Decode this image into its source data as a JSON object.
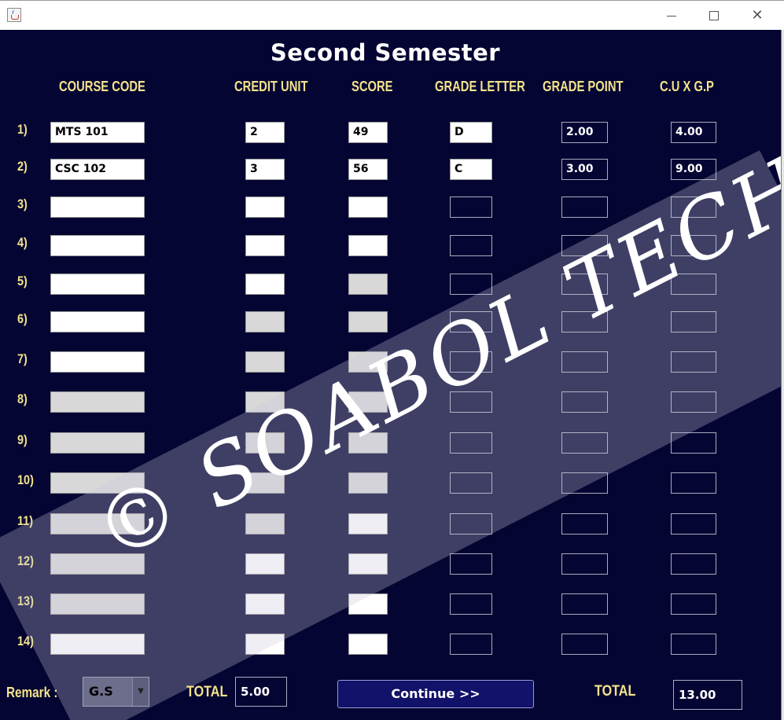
{
  "window": {
    "minimize_glyph": "",
    "maximize_glyph": "",
    "close_glyph": "✕"
  },
  "heading": "Second Semester",
  "columns": {
    "course_code": "COURSE CODE",
    "credit_unit": "CREDIT UNIT",
    "score": "SCORE",
    "grade_letter": "GRADE LETTER",
    "grade_point": "GRADE POINT",
    "cu_x_gp": "C.U  X  G.P"
  },
  "rows": [
    {
      "num": "1)",
      "course_code": "MTS 101",
      "credit_unit": "2",
      "score": "49",
      "grade_letter": "D",
      "grade_point": "2.00",
      "cu_x_gp": "4.00"
    },
    {
      "num": "2)",
      "course_code": "CSC 102",
      "credit_unit": "3",
      "score": "56",
      "grade_letter": "C",
      "grade_point": "3.00",
      "cu_x_gp": "9.00"
    },
    {
      "num": "3)",
      "course_code": "",
      "credit_unit": "",
      "score": "",
      "grade_letter": "",
      "grade_point": "",
      "cu_x_gp": ""
    },
    {
      "num": "4)",
      "course_code": "",
      "credit_unit": "",
      "score": "",
      "grade_letter": "",
      "grade_point": "",
      "cu_x_gp": ""
    },
    {
      "num": "5)",
      "course_code": "",
      "credit_unit": "",
      "score": "",
      "grade_letter": "",
      "grade_point": "",
      "cu_x_gp": ""
    },
    {
      "num": "6)",
      "course_code": "",
      "credit_unit": "",
      "score": "",
      "grade_letter": "",
      "grade_point": "",
      "cu_x_gp": ""
    },
    {
      "num": "7)",
      "course_code": "",
      "credit_unit": "",
      "score": "",
      "grade_letter": "",
      "grade_point": "",
      "cu_x_gp": ""
    },
    {
      "num": "8)",
      "course_code": "",
      "credit_unit": "",
      "score": "",
      "grade_letter": "",
      "grade_point": "",
      "cu_x_gp": ""
    },
    {
      "num": "9)",
      "course_code": "",
      "credit_unit": "",
      "score": "",
      "grade_letter": "",
      "grade_point": "",
      "cu_x_gp": ""
    },
    {
      "num": "10)",
      "course_code": "",
      "credit_unit": "",
      "score": "",
      "grade_letter": "",
      "grade_point": "",
      "cu_x_gp": ""
    },
    {
      "num": "11)",
      "course_code": "",
      "credit_unit": "",
      "score": "",
      "grade_letter": "",
      "grade_point": "",
      "cu_x_gp": ""
    },
    {
      "num": "12)",
      "course_code": "",
      "credit_unit": "",
      "score": "",
      "grade_letter": "",
      "grade_point": "",
      "cu_x_gp": ""
    },
    {
      "num": "13)",
      "course_code": "",
      "credit_unit": "",
      "score": "",
      "grade_letter": "",
      "grade_point": "",
      "cu_x_gp": ""
    },
    {
      "num": "14)",
      "course_code": "",
      "credit_unit": "",
      "score": "",
      "grade_letter": "",
      "grade_point": "",
      "cu_x_gp": ""
    }
  ],
  "watermark": "© SOABOL TECH",
  "footer": {
    "remark_label": "Remark :",
    "remark_value": "G.S",
    "total_label": "TOTAL",
    "total_credit": "5.00",
    "continue_label": "Continue >>",
    "total_label_2": "TOTAL",
    "total_points": "13.00"
  }
}
